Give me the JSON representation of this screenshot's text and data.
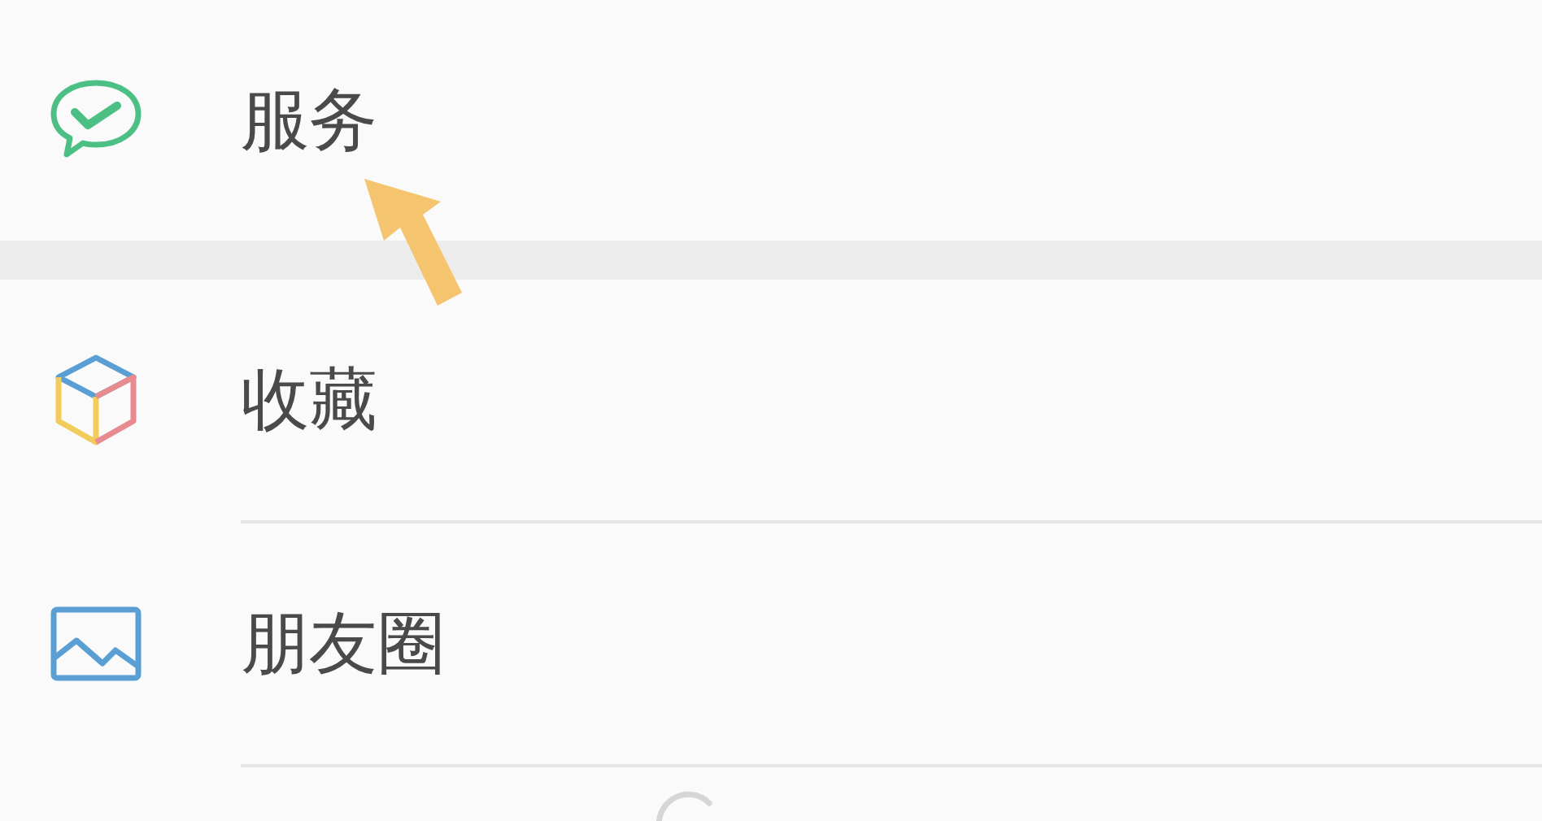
{
  "sections": [
    {
      "items": [
        {
          "label": "服务",
          "kind": "service"
        }
      ]
    },
    {
      "items": [
        {
          "label": "收藏",
          "kind": "favorites"
        },
        {
          "label": "朋友圈",
          "kind": "moments"
        }
      ]
    }
  ]
}
